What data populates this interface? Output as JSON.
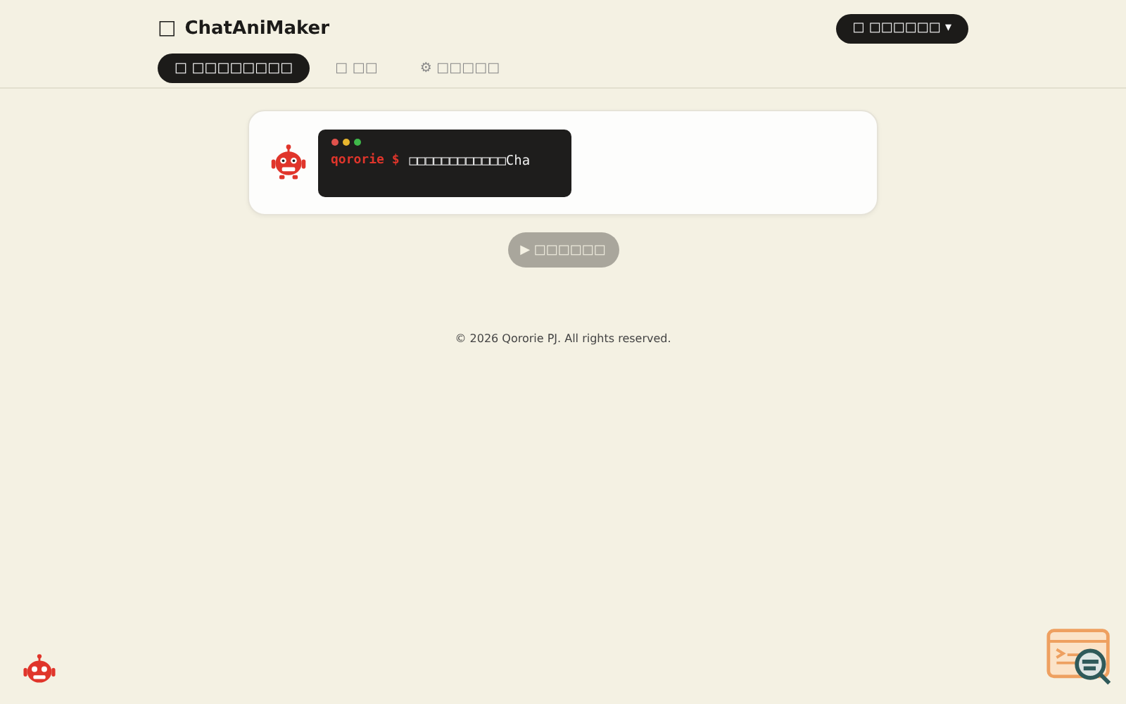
{
  "header": {
    "logo_icon": "□",
    "title": "ChatAniMaker",
    "language_button": "□ □□□□□□ ▾"
  },
  "tabs": [
    {
      "label": "□ □□□□□□□□",
      "selected": true
    },
    {
      "label": "□ □□",
      "selected": false
    },
    {
      "label": "⚙ □□□□□",
      "selected": false
    }
  ],
  "terminal": {
    "prompt": "qororie $",
    "text": "□□□□□□□□□□□□Cha"
  },
  "play_button": {
    "label": "▶ □□□□□□",
    "disabled": true
  },
  "footer": "© 2026 Qororie PJ. All rights reserved."
}
